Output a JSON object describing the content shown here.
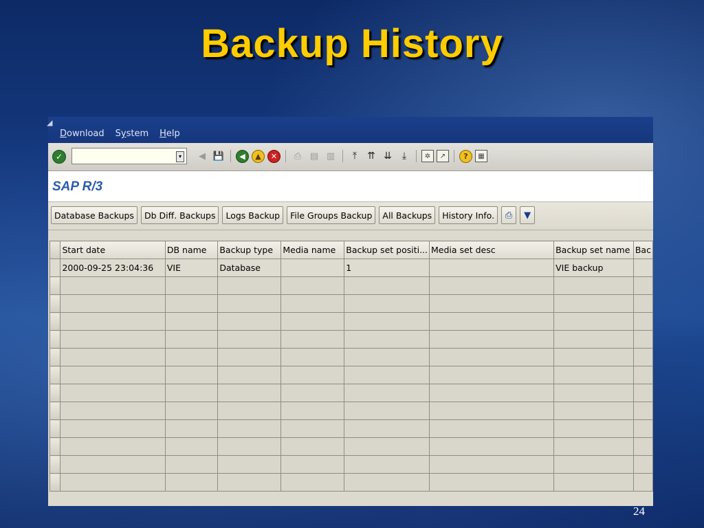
{
  "slide": {
    "title": "Backup History",
    "page_number": "24"
  },
  "sap": {
    "menu": [
      {
        "label": "Download",
        "underline": "D",
        "rest": "ownload"
      },
      {
        "label": "System",
        "underline": "y",
        "before": "S",
        "rest": "stem"
      },
      {
        "label": "Help",
        "underline": "H",
        "rest": "elp"
      }
    ],
    "command_field": {
      "value": ""
    },
    "app_title": "SAP R/3",
    "app_buttons": [
      "Database Backups",
      "Db Diff. Backups",
      "Logs Backup",
      "File Groups Backup",
      "All Backups",
      "History Info."
    ],
    "icons": {
      "print": "printer-icon",
      "filter": "filter-icon"
    },
    "grid": {
      "columns": [
        "Start date",
        "DB name",
        "Backup type",
        "Media name",
        "Backup set positi...",
        "Media set desc",
        "Backup set name",
        "Bac"
      ],
      "rows": [
        [
          "2000-09-25 23:04:36",
          "VIE",
          "Database",
          "",
          "1",
          "",
          "VIE backup",
          ""
        ]
      ]
    }
  }
}
